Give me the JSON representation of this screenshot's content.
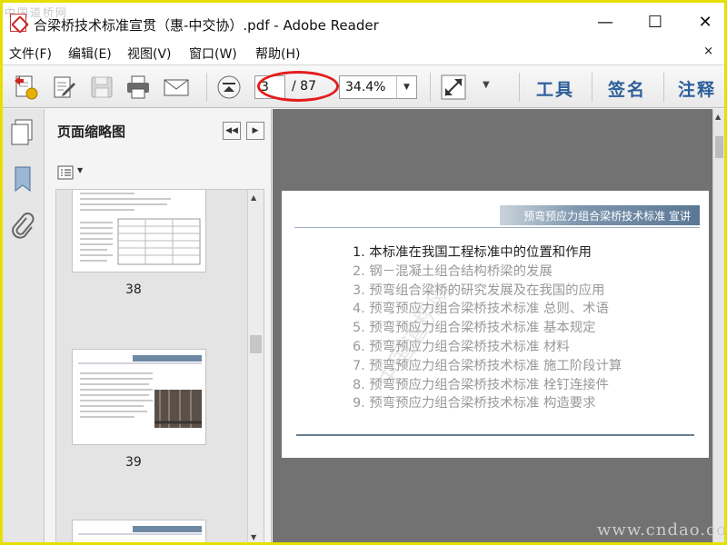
{
  "window": {
    "title": "合梁桥技术标准宣贯（惠-中交协）.pdf - Adobe Reader",
    "minimize": "—",
    "maximize": "☐",
    "close": "✕"
  },
  "watermark": {
    "top": "中国道桥网",
    "bottom": "www.cndao.com",
    "page": "中国道桥网"
  },
  "menu": {
    "items": [
      "文件(F)",
      "编辑(E)",
      "视图(V)",
      "窗口(W)",
      "帮助(H)"
    ],
    "close": "×"
  },
  "toolbar": {
    "page_current": "3",
    "page_total": "/ 87",
    "zoom": "34.4%",
    "tools_label": "工具",
    "sign_label": "签名",
    "comment_label": "注释"
  },
  "thumb_panel": {
    "title": "页面缩略图",
    "thumbnails": [
      {
        "page": "38"
      },
      {
        "page": "39"
      }
    ]
  },
  "document": {
    "header": "预弯预应力组合梁桥技术标准 宣讲",
    "toc": [
      "1. 本标准在我国工程标准中的位置和作用",
      "2. 钢－混凝土组合结构桥梁的发展",
      "3. 预弯组合梁桥的研究发展及在我国的应用",
      "4. 预弯预应力组合梁桥技术标准  总则、术语",
      "5. 预弯预应力组合梁桥技术标准  基本规定",
      "6. 预弯预应力组合梁桥技术标准  材料",
      "7. 预弯预应力组合梁桥技术标准  施工阶段计算",
      "8. 预弯预应力组合梁桥技术标准  栓钉连接件",
      "9. 预弯预应力组合梁桥技术标准  构造要求"
    ]
  },
  "colors": {
    "accent_link": "#2d5f9a",
    "annotation_red": "#e41d1d",
    "frame_yellow": "#e6e000"
  }
}
